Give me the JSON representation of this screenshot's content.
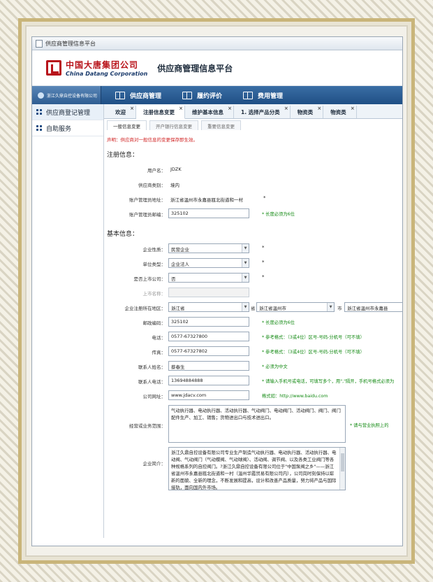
{
  "window": {
    "title": "供应商管理信息平台"
  },
  "header": {
    "company_cn": "中国大唐集团公司",
    "company_en": "China Datang Corporation",
    "platform_title": "供应商管理信息平台"
  },
  "navbar": {
    "user": "浙江久鼎自控设备有限公司",
    "items": [
      {
        "label": "供应商管理",
        "icon": "book-icon"
      },
      {
        "label": "履约评价",
        "icon": "book-icon"
      },
      {
        "label": "费用管理",
        "icon": "book-icon"
      }
    ]
  },
  "sidebar": {
    "items": [
      {
        "label": "供应商登记管理",
        "icon": "grid-icon",
        "active": true
      },
      {
        "label": "自助服务",
        "icon": "grid-icon",
        "active": false
      }
    ]
  },
  "tabs": [
    {
      "label": "欢迎",
      "close": "×"
    },
    {
      "label": "注册信息变更",
      "close": "×",
      "active": true
    },
    {
      "label": "维护基本信息",
      "close": "×"
    },
    {
      "label": "1. 选择产品分类",
      "close": "×"
    },
    {
      "label": "物资类",
      "close": "×"
    },
    {
      "label": "物资类",
      "close": "×"
    }
  ],
  "subtabs": [
    {
      "label": "一般信息变更",
      "active": true
    },
    {
      "label": "开户银行信息变更"
    },
    {
      "label": "重要信息变更"
    }
  ],
  "notice": "声明：供应商对一般信息的变更保存即生效。",
  "registration": {
    "title": "注册信息：",
    "username_label": "用户名：",
    "username": "JDZK",
    "type_label": "供应商类别：",
    "type": "境内",
    "admin_address_label": "账户管理员地址：",
    "admin_address": "浙江省温州市永嘉县瓯北街道和一村",
    "admin_postcode_label": "账户管理员邮编：",
    "admin_postcode": "325102",
    "admin_postcode_hint": "* 长度必须为6位",
    "star": "*"
  },
  "basic": {
    "title": "基本信息：",
    "nature_label": "企业性质：",
    "nature": "民营企业",
    "unit_type_label": "单位类型：",
    "unit_type": "企业法人",
    "listed_label": "是否上市公司：",
    "listed": "否",
    "listed_name_label": "上市名称：",
    "listed_name": "",
    "region_label": "企业注册所在地区：",
    "province": "浙江省",
    "province_suffix": "省",
    "city": "浙江省温州市",
    "city_suffix": "市",
    "county": "浙江省温州市永嘉县",
    "postcode_label": "邮政编码：",
    "postcode": "325102",
    "postcode_hint": "* 长度必须为6位",
    "phone_label": "电话：",
    "phone": "0577-67327800",
    "phone_hint": "* 参考格式：（3或4位）区号-号码-分机号（可不填）",
    "fax_label": "传真：",
    "fax": "0577-67327802",
    "fax_hint": "* 参考格式：（3或4位）区号-号码-分机号（可不填）",
    "contact_name_label": "联系人姓名：",
    "contact_name": "蔡春生",
    "contact_name_hint": "* 必须为中文",
    "contact_phone_label": "联系人电话：",
    "contact_phone": "13694884888",
    "contact_phone_hint": "* 请输入手机号或电话，可填写多个，用\",\"隔开，手机号格式必须为",
    "website_label": "公司网址：",
    "website": "www.jdacv.com",
    "website_hint": "格式如：http://www.baidu.com",
    "scope_label": "经营或业务范围：",
    "scope": "气动执行器、电动执行器、活动执行器、气动阀门、电动阀门、活动阀门、阀门、阀门配件生产、加工、销售；货物进出口与技术进出口。",
    "scope_hint": "* 请与营业执照上的",
    "intro_label": "企业简介：",
    "intro": "浙江久鼎自控设备有限公司专业生产制造气动执行器、电动执行器、活动执行器、电动阀、气动阀门（气动蝶阀、气动球阀）、活动阀、调节阀、以及各类工业阀门等各种规格系列的自控阀门。?浙江久鼎自控设备有限公司位于\"中国泵阀之乡\"——浙江省温州市永嘉县瓯北街道和一村（温州华霞贸易有限公司内），公司岗时刻保持以崭新的面貌、全新的理念，不断发展和提高，设计和改善产品质量，努力将产品与国际接轨，面向国内外市场。",
    "star": "*"
  }
}
